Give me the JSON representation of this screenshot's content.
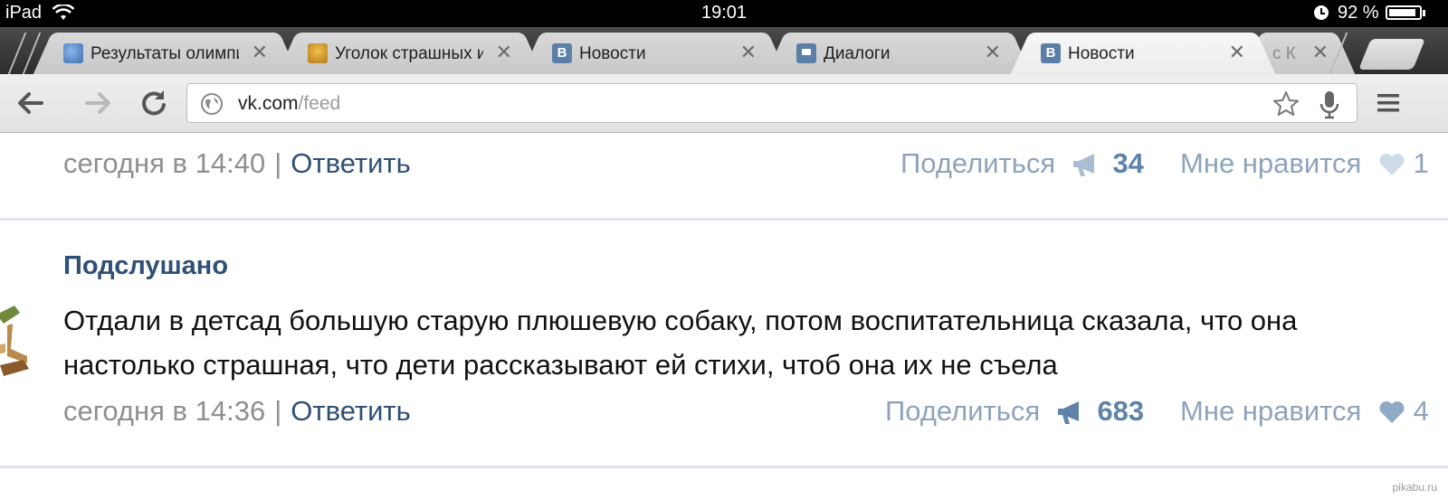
{
  "status_bar": {
    "device": "iPad",
    "time": "19:01",
    "battery_percent": "92 %",
    "battery_level": 0.92
  },
  "tabs": [
    {
      "label": "Результаты олимпиа",
      "icon": "globe-favicon"
    },
    {
      "label": "Уголок страшных ист",
      "icon": "cupcake-favicon"
    },
    {
      "label": "Новости",
      "icon": "vk-favicon"
    },
    {
      "label": "Диалоги",
      "icon": "messages-favicon"
    },
    {
      "label": "Новости",
      "icon": "vk-favicon",
      "active": true
    },
    {
      "label": "с К",
      "icon": ""
    }
  ],
  "address_bar": {
    "host": "vk.com",
    "path": "/feed"
  },
  "vk_favicon_letter": "B",
  "feed": {
    "post1": {
      "time": "сегодня в 14:40",
      "separator": "|",
      "reply": "Ответить",
      "share_label": "Поделиться",
      "share_count": "34",
      "like_label": "Мне нравится",
      "like_count": "1"
    },
    "post2": {
      "author": "Подслушано",
      "text": "Отдали в детсад большую старую плюшевую собаку, потом воспитательница сказала, что она настолько страшная, что дети рассказывают ей стихи, чтоб она их не съела",
      "time": "сегодня в 14:36",
      "separator": "|",
      "reply": "Ответить",
      "share_label": "Поделиться",
      "share_count": "683",
      "like_label": "Мне нравится",
      "like_count": "4"
    }
  },
  "watermark": "pikabu.ru",
  "colors": {
    "vk_link": "#2f5077",
    "muted_text": "#8f8f8f",
    "share_text": "#8fa3bb",
    "share_count": "#5e82aa"
  }
}
